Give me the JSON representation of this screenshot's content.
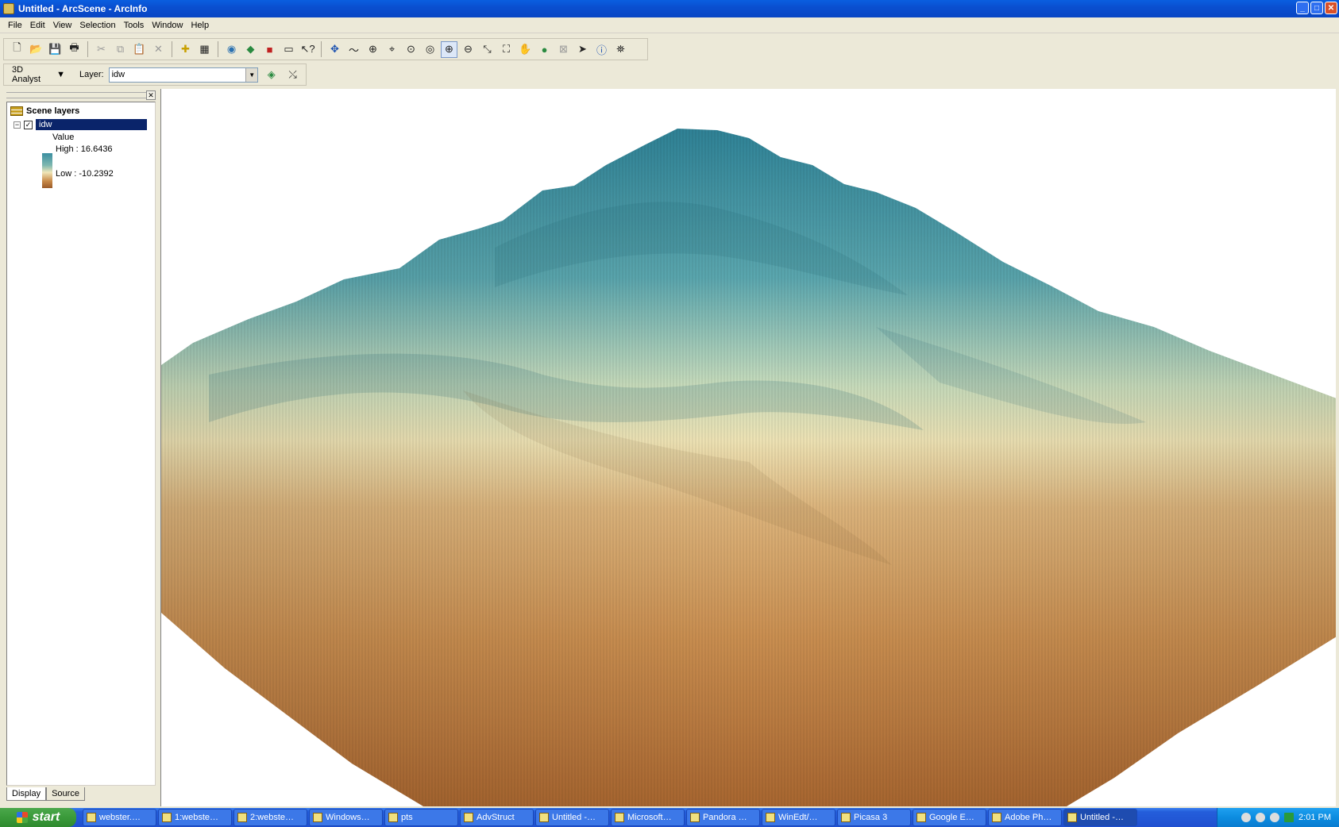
{
  "window": {
    "title": "Untitled - ArcScene - ArcInfo"
  },
  "menu": [
    "File",
    "Edit",
    "View",
    "Selection",
    "Tools",
    "Window",
    "Help"
  ],
  "toolbar2": {
    "analyst_label": "3D Analyst",
    "layer_label": "Layer:",
    "layer_value": "idw"
  },
  "toc": {
    "root_label": "Scene layers",
    "layer_name": "idw",
    "legend_heading": "Value",
    "high_label": "High : 16.6436",
    "low_label": "Low : -10.2392",
    "tabs": [
      "Display",
      "Source"
    ]
  },
  "taskbar": {
    "start_label": "start",
    "tasks": [
      "webster.…",
      "1:webste…",
      "2:webste…",
      "Windows…",
      "pts",
      "AdvStruct",
      "Untitled -…",
      "Microsoft…",
      "Pandora …",
      "WinEdt/…",
      "Picasa 3",
      "Google E…",
      "Adobe Ph…",
      "Untitled -…"
    ],
    "clock": "2:01 PM"
  },
  "colors": {
    "titlebar": "#0a4fd0",
    "selection": "#0a246a",
    "terrain_high": "#3a8ea0",
    "terrain_low": "#9a5a28"
  }
}
